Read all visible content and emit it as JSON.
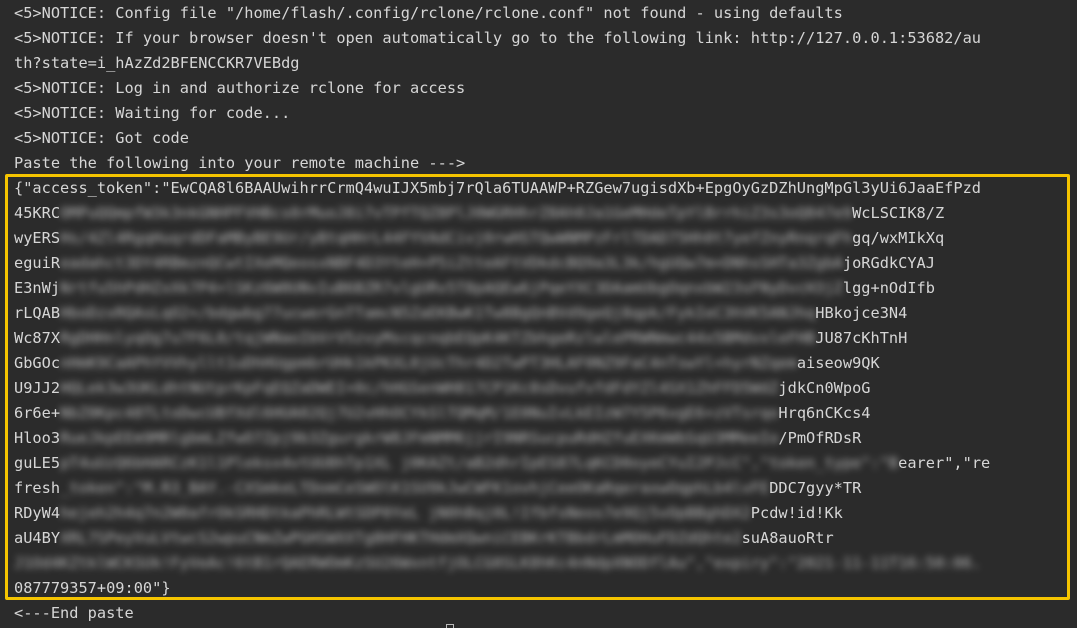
{
  "terminal": {
    "lines": [
      "<5>NOTICE: Config file \"/home/flash/.config/rclone/rclone.conf\" not found - using defaults",
      "<5>NOTICE: If your browser doesn't open automatically go to the following link: http://127.0.0.1:53682/au",
      "th?state=i_hAzZd2BFENCCKR7VEBdg",
      "<5>NOTICE: Log in and authorize rclone for access",
      "<5>NOTICE: Waiting for code...",
      "<5>NOTICE: Got code",
      "Paste the following into your remote machine --->"
    ],
    "token_block": [
      {
        "left": "{\"access_token\":\"EwCQA8l6BAAUwihrrCrmQ4wuIJX5mbj7rQla6TUAAWP+RZGew7ugisdXb+EpgOyGzDZhUngMpGl3yUi6JaaEfPzd",
        "blur": "",
        "right": ""
      },
      {
        "left": "45KRC",
        "blur": "OMPuQQmpfW3k3nkGNHPFVHBcs0rMuoJ8i7vTPfTQZ8PlJ0WGRHhrZ8Ah0Ja1GeMHdeTpYlBrrhiZ3s3oQ847e9",
        "right": "WcLSCIK8/Z"
      },
      {
        "left": "wyERS",
        "blur": "Hs/4Zl4RgqHuqrdDFaMByBE9Ur/yBtqHHrL44FYVAdCivj0rwHSTQwWNMPzFrlTDAD75Hh0t7yefZnyRnqrqFh",
        "right": "gq/wxMIkXq"
      },
      {
        "left": "eguiR",
        "blur": "eadahct3DY4RBmznQCwtIXeMQeosxNBF4D3YteH+P5iZtteAFtVDkdcBQ9a3L3k/hgUQw7m+DNhsSHTa3ZgbA",
        "right": "joRGdkCYAJ"
      },
      {
        "left": "E3nWj",
        "blur": "Nrtfu5hPdHZxXk7P4+lSKz6W0UNvIuB6BZR7vlgURv5T8pAQEw6jPqeYXC3DAamUbgOqnxbW23sFNyDvcH3jZ",
        "right": "lgg+nOdIfb"
      },
      {
        "left": "rLQAB",
        "blur": "HboDzxRQAsLqO2+/bdgwbg77ucwerGnTTamcN5ZaEKBwK1Tw8BgQnBVd9geQj8qpk/FykIeC3hVK5ANJhq",
        "right": "HBkojce3N4"
      },
      {
        "left": "Wc87X",
        "blur": "RgDHHnlyqOg7u7F6L0/tqjWNaoIbVrV5zvyMscqcnqbEQpK4KTZbhgeRzlwlePRWNmwc44x5BMdvxleFHB",
        "right": "JU87cKhTnH"
      },
      {
        "left": "GbGOc",
        "blur": "nHmK9CaAPhYVVhyllt1uDhHUgpmbrUHk1kPKXL0jUcThr4D2TwPT3HLAF0NZ9FaC4nTswYl+hyrNZqem",
        "right": "aiseow9QK"
      },
      {
        "left": "U9JJ2",
        "blur": "HQLek3w3UKLdhtNUtprKpFqEQZaDWEI+0c/hHGSenWH817CP1Kc8sDvufvfdFdYZl4SX1ZhFFD5WdZ",
        "right": "jdkCn0WpoG"
      },
      {
        "left": "6r6e+",
        "blur": "NbZ0Kpc48TLtoDwcUBfXdl6HUA02Qj7U2vHhOCYkSlTQMqM/1E0NuIvLkEIzW7Y5P6vgE6+zVTsrqo",
        "right": "Hrq6nCKcs4"
      },
      {
        "left": "Hloo3",
        "blur": "RueJkpEEm9MRlgbmLZfwO7Zpj9b3ZgurgkrW8JFmNMM6jjrI9NRSucpuRdHZfuEXKmWbSqU3MMeeIo",
        "right": "/PmOfRDsR"
      },
      {
        "left": "guLE5",
        "blur": "pT4uUzQ6bHARCzK1l1Pleksx4vtUU8hTp1XL j0KAZt/aB2dhrIpES87LqKCD0oyeCYuI2PJcC\",\"token_type\":\"B",
        "right": "earer\",\"re"
      },
      {
        "left": "fresh",
        "blur": "_token\":\"M.R3_BAY.-CXSmkeLTDomCeSWOlK1SU9kJwCWFK1ovhjCeeOKaRqeraxwOqphLb4lvFE",
        "right": "DDC7gyy*TR"
      },
      {
        "left": "RDyW4",
        "blur": "hejeh2h4q7n2W0afrOkSRHDtkaPhRLWtSDP0YeL jN0hBqj0L!IfbfsNeos7e9Qj5vOpBBghDX2",
        "right": "Pcdw!id!Kk"
      },
      {
        "left": "aU4BY",
        "blur": "XRL7SPeyVuLVtwcS2wpuCNmZwPGHSWXXTg8HFHKTHdmXQwniCEBKrKTBbdrLmMOHuFDZdQhte2",
        "right": "suA8auoRtr"
      },
      {
        "left": "",
        "blur": "J1Od4KZtklWCKSUk!FyVeAc!6tB1rQAERWOmKzSU26WxntfjOLCG0SLK8hKc4nNdpXNODflAu\",\"expiry\":\"2021-11-11T16:50:06.",
        "right": ""
      },
      {
        "left": "087779357+09:00\"}",
        "blur": "",
        "right": ""
      }
    ],
    "end_line": "<---End paste"
  }
}
